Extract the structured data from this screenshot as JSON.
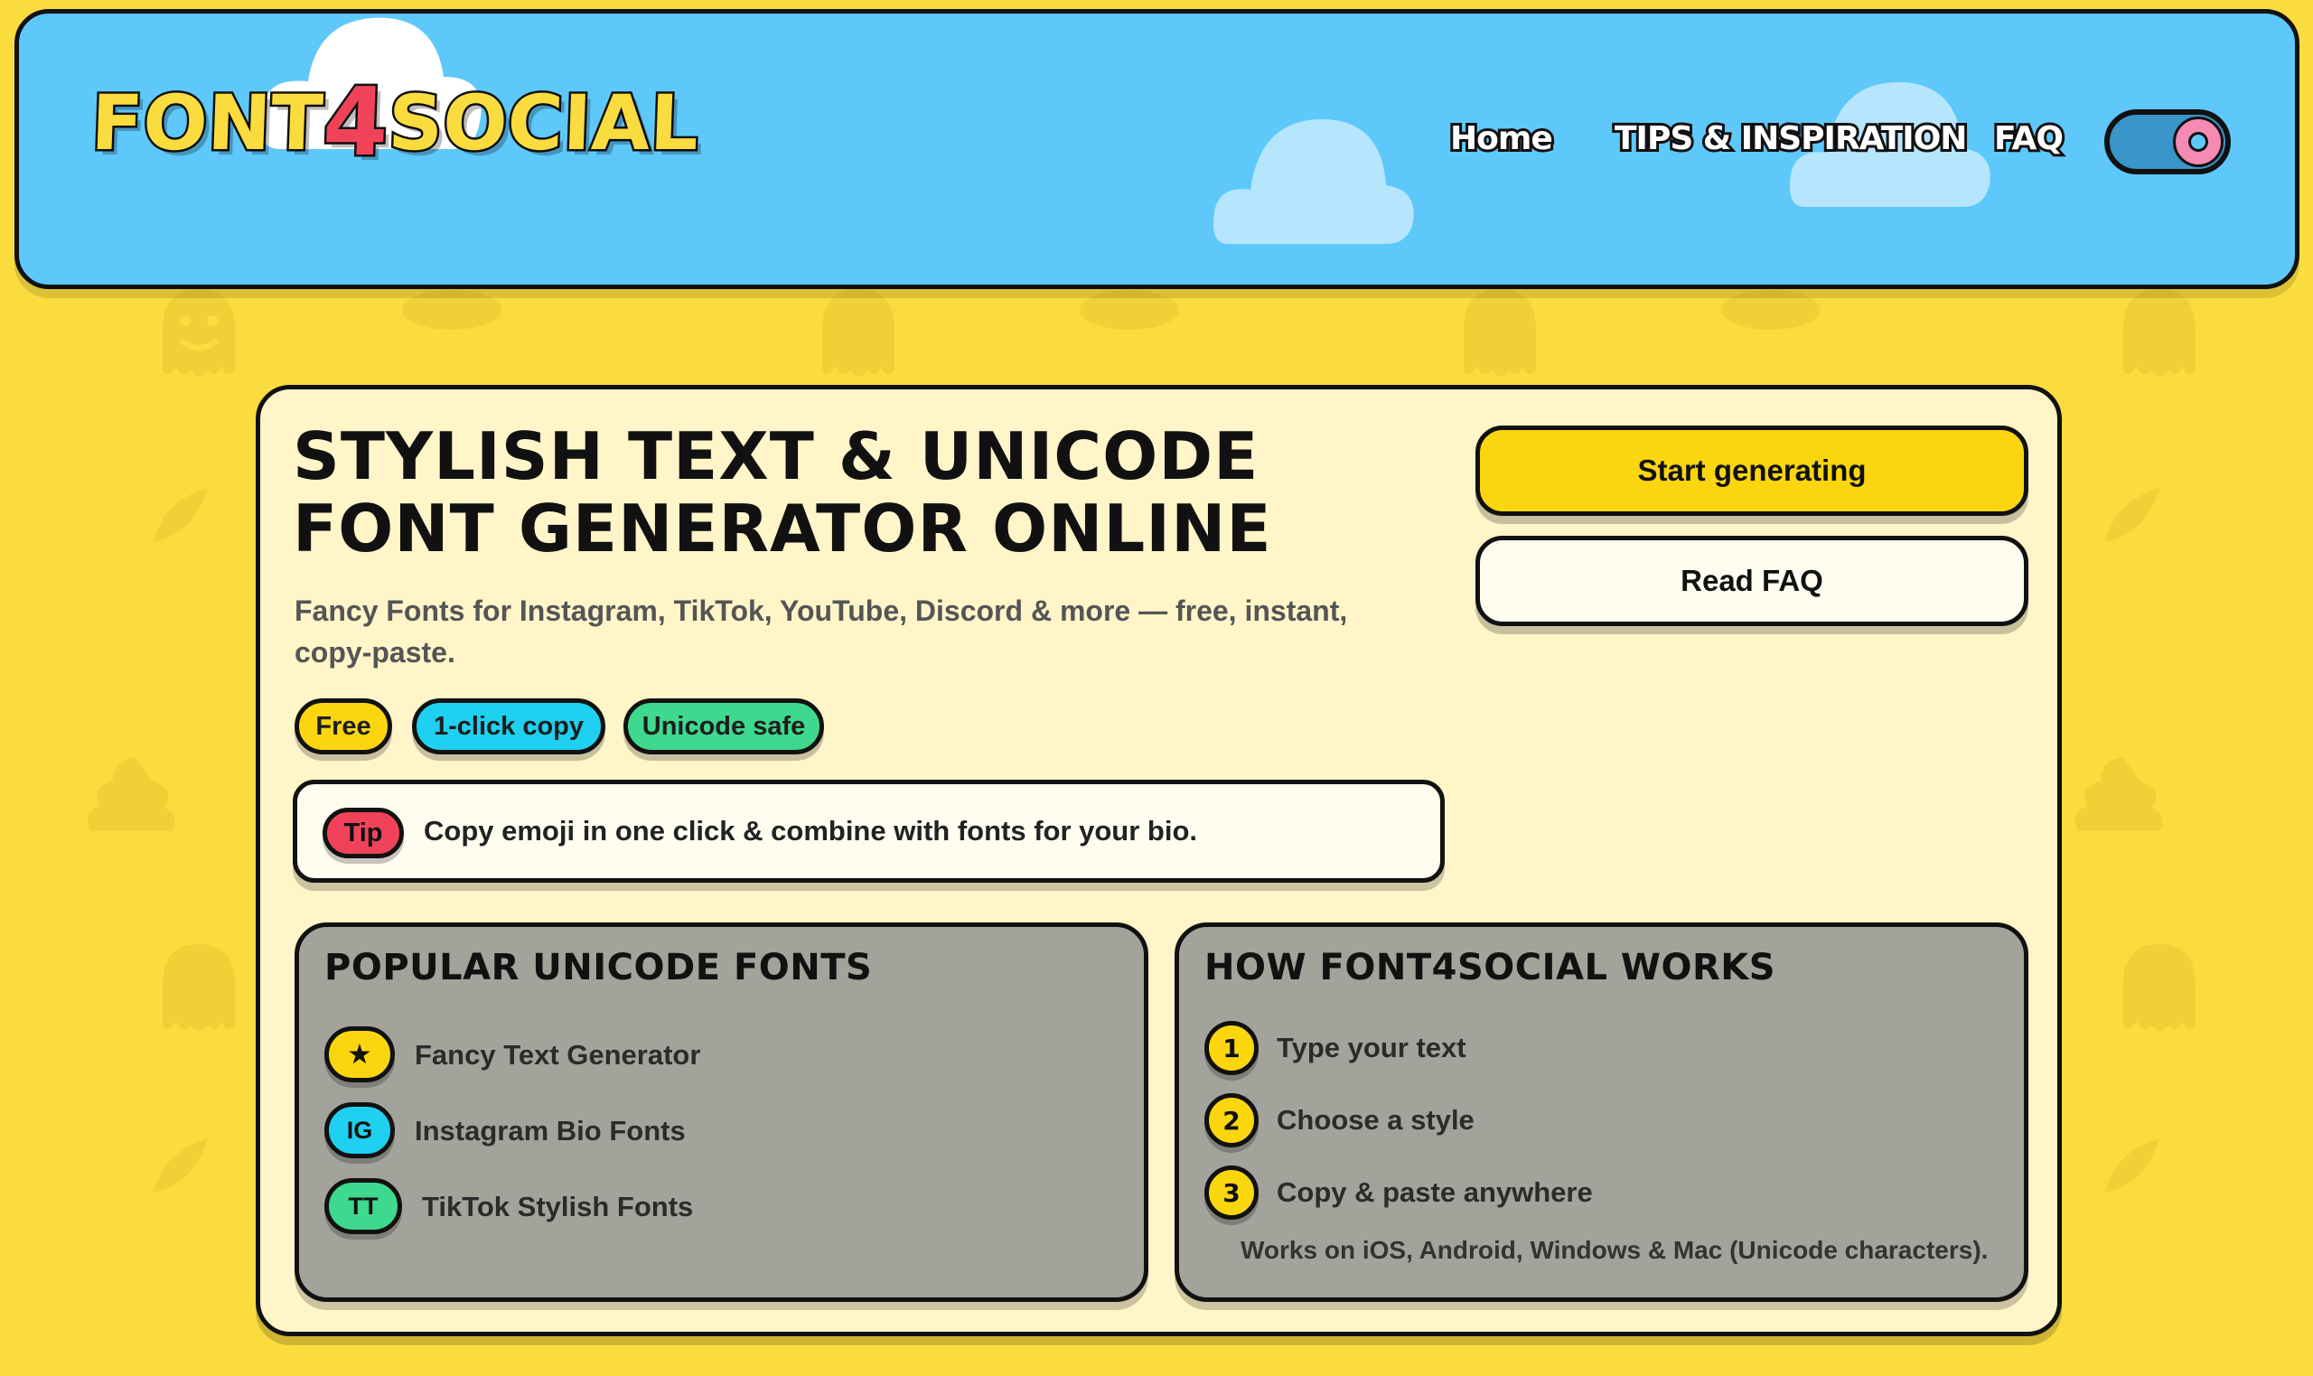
{
  "header": {
    "logo_left": "FONT",
    "logo_four": "4",
    "logo_right": "SOCIAL",
    "nav": [
      "Home",
      "TIPS & INSPIRATION",
      "FAQ"
    ],
    "theme_toggle_icon": "donut-icon"
  },
  "hero": {
    "title": "STYLISH TEXT & UNICODE FONT GENERATOR ONLINE",
    "subtitle": "Fancy Fonts for Instagram, TikTok, YouTube, Discord & more — free, instant, copy-paste.",
    "pills": [
      {
        "label": "Free",
        "color": "#fbd60f"
      },
      {
        "label": "1-click copy",
        "color": "#1fd0f0"
      },
      {
        "label": "Unicode safe",
        "color": "#3ed98e"
      }
    ],
    "tip": {
      "badge": "Tip",
      "text": "Copy emoji in one click & combine with fonts for your bio."
    },
    "buttons": {
      "primary": "Start generating",
      "secondary": "Read FAQ"
    }
  },
  "popular": {
    "title": "POPULAR UNICODE FONTS",
    "items": [
      {
        "badge": "★",
        "label": "Fancy Text Generator",
        "color": "#fbd60f"
      },
      {
        "badge": "IG",
        "label": "Instagram Bio Fonts",
        "color": "#1fd0f0"
      },
      {
        "badge": "TT",
        "label": "TikTok Stylish Fonts",
        "color": "#3ed98e"
      }
    ]
  },
  "how": {
    "title": "HOW FONT4SOCIAL WORKS",
    "steps": [
      {
        "num": "1",
        "label": "Type your text"
      },
      {
        "num": "2",
        "label": "Choose a style"
      },
      {
        "num": "3",
        "label": "Copy & paste anywhere"
      }
    ],
    "note": "Works on iOS, Android, Windows & Mac (Unicode characters)."
  },
  "colors": {
    "accent_yellow": "#fbd60f",
    "sky": "#5ec8fb",
    "red": "#f0435a"
  }
}
